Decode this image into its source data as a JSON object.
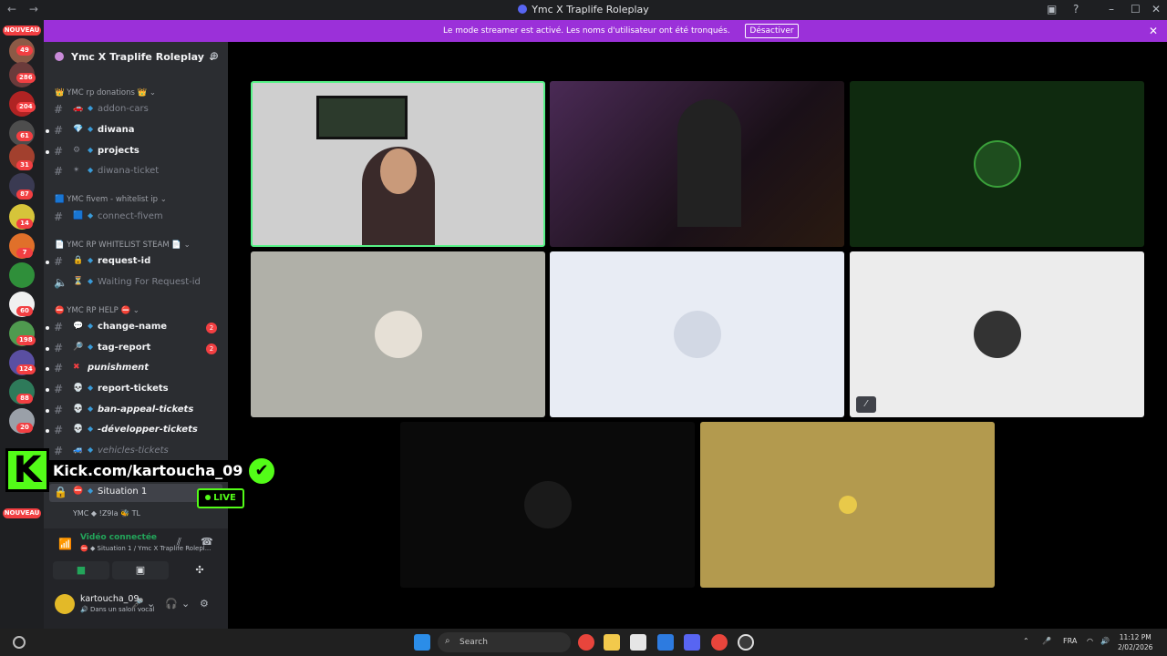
{
  "window": {
    "title": "Ymc X Traplife Roleplay",
    "nav_back": "←",
    "nav_forward": "→"
  },
  "banner": {
    "message": "Le mode streamer est activé. Les noms d'utilisateur ont été tronqués.",
    "button": "Désactiver",
    "close": "✕"
  },
  "server_rail": {
    "badges": [
      "49",
      "286",
      "204",
      "61",
      "31",
      "87",
      "14",
      "7",
      "60",
      "198",
      "124",
      "88",
      "20"
    ],
    "top_label": "NOUVEAU",
    "bottom_label": "NOUVEAU"
  },
  "server": {
    "name": "Ymc X Traplife Roleplay ⌄",
    "add_icon": "person-add-icon"
  },
  "categories": [
    {
      "label": "👑 YMC rp donations 👑 ⌄"
    },
    {
      "label": "🟦 YMC fivem - whitelist ip ⌄"
    },
    {
      "label": "📄 YMC RP WHITELIST STEAM 📄 ⌄"
    },
    {
      "label": "⛔ YMC RP HELP ⛔ ⌄"
    }
  ],
  "channels": [
    {
      "emoji": "🚗",
      "label": "addon-cars"
    },
    {
      "emoji": "💎",
      "label": "diwana"
    },
    {
      "emoji": "⚙",
      "label": "projects"
    },
    {
      "emoji": "✴",
      "label": "diwana-ticket"
    },
    {
      "emoji": "🟦",
      "label": "connect-fivem"
    },
    {
      "emoji": "🔒",
      "label": "request-id"
    },
    {
      "emoji": "⏳",
      "label": "Waiting For Request-id"
    },
    {
      "emoji": "💬",
      "label": "change-name",
      "count": "2"
    },
    {
      "emoji": "🔎",
      "label": "tag-report",
      "count": "2"
    },
    {
      "emoji": "✖",
      "label": "punishment"
    },
    {
      "emoji": "💀",
      "label": "report-tickets"
    },
    {
      "emoji": "💀",
      "label": "ban-appeal-tickets"
    },
    {
      "emoji": "💀",
      "label": "-développer-tickets"
    },
    {
      "emoji": "🚙",
      "label": "vehicles-tickets"
    },
    {
      "emoji": "⛔",
      "label": "Situation 1"
    }
  ],
  "voice_users": "YMC  ◆  !Z9la  🐝 TL",
  "overlay": {
    "kick_logo": "K",
    "kick_url": "Kick.com/kartoucha_09",
    "check": "✔",
    "live": "LIVE"
  },
  "voice_panel": {
    "status": "Vidéo connectée",
    "location": "⛔ ◆ Situation 1 / Ymc X Traplife Rolepl...",
    "signal_icon": "signal-icon",
    "camera_icon": "camera-icon",
    "screen_icon": "screen-share-icon",
    "activity_icon": "activity-icon"
  },
  "user": {
    "name": "kartoucha_09",
    "status": "🔊 Dans un salon vocal"
  },
  "taskbar": {
    "search_placeholder": "Search",
    "lang": "FRA",
    "time": "11:12 PM",
    "date": "2/02/2026"
  },
  "colors": {
    "banner": "#9b30d9",
    "kick_green": "#53fc18",
    "speaking_border": "#57f287",
    "sidebar": "#2b2d31",
    "rail": "#1e1f22"
  }
}
